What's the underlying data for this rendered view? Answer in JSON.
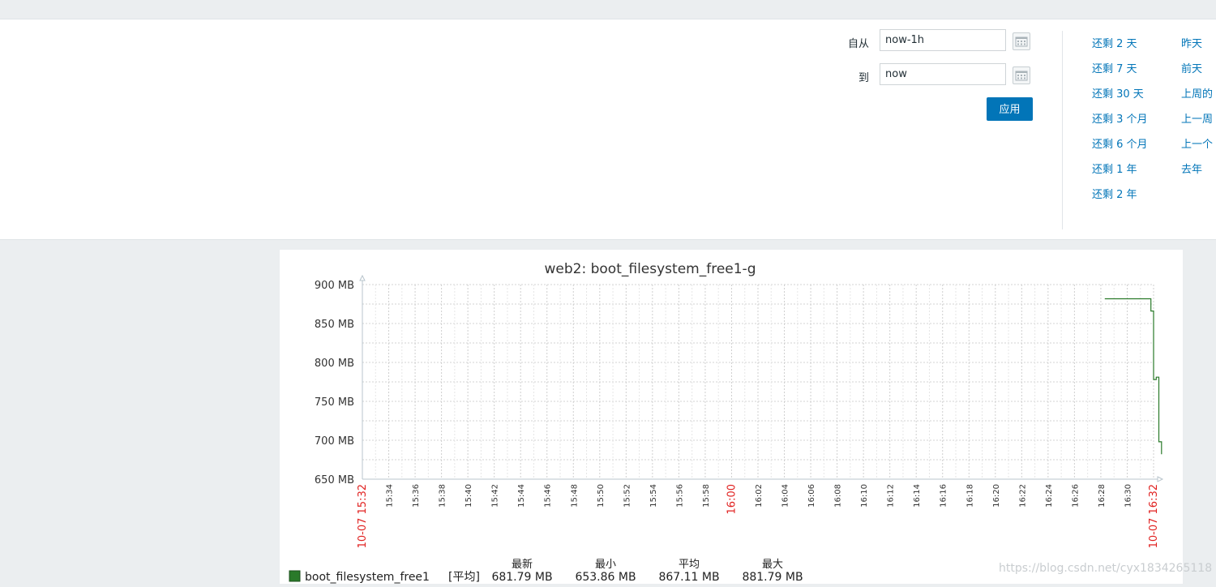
{
  "filter": {
    "from_label": "自从",
    "from_value": "now-1h",
    "to_label": "到",
    "to_value": "now",
    "apply_label": "应用",
    "quick_col1": [
      "还剩 2 天",
      "还剩 7 天",
      "还剩 30 天",
      "还剩 3 个月",
      "还剩 6 个月",
      "还剩 1 年",
      "还剩 2 年"
    ],
    "quick_col2": [
      "昨天",
      "前天",
      "上周的",
      "上一周",
      "上一个",
      "去年"
    ]
  },
  "graph": {
    "title": "web2: boot_filesystem_free1-g",
    "line_color": "#2a7a2a",
    "highlight_tick_color": "#e0201f",
    "legend": {
      "item_name": "boot_filesystem_free1",
      "bracket": "[平均]",
      "columns": [
        {
          "header": "最新",
          "value": "681.79 MB"
        },
        {
          "header": "最小",
          "value": "653.86 MB"
        },
        {
          "header": "平均",
          "value": "867.11 MB"
        },
        {
          "header": "最大",
          "value": "881.79 MB"
        }
      ]
    }
  },
  "chart_data": {
    "type": "line",
    "title": "web2: boot_filesystem_free1-g",
    "ylim": [
      650,
      900
    ],
    "y_ticks": [
      "900 MB",
      "850 MB",
      "800 MB",
      "750 MB",
      "700 MB",
      "650 MB"
    ],
    "x_ticks": [
      "10-07 15:32",
      "15:34",
      "15:36",
      "15:38",
      "15:40",
      "15:42",
      "15:44",
      "15:46",
      "15:48",
      "15:50",
      "15:52",
      "15:54",
      "15:56",
      "15:58",
      "16:00",
      "16:02",
      "16:04",
      "16:06",
      "16:08",
      "16:10",
      "16:12",
      "16:14",
      "16:16",
      "16:18",
      "16:20",
      "16:22",
      "16:24",
      "16:26",
      "16:28",
      "16:30",
      "10-07 16:32"
    ],
    "red_ticks": [
      "10-07 15:32",
      "16:00",
      "10-07 16:32"
    ],
    "xlim_minutes": [
      0,
      60
    ],
    "grid": true,
    "series": [
      {
        "name": "boot_filesystem_free1",
        "points": [
          [
            56.3,
            881.8
          ],
          [
            59.8,
            881.8
          ],
          [
            59.8,
            866
          ],
          [
            60.0,
            866
          ],
          [
            60.0,
            778
          ],
          [
            60.2,
            778
          ],
          [
            60.2,
            781
          ],
          [
            60.4,
            781
          ],
          [
            60.4,
            698
          ],
          [
            60.6,
            698
          ],
          [
            60.6,
            682
          ]
        ]
      }
    ]
  },
  "watermark": "https://blog.csdn.net/cyx1834265118"
}
